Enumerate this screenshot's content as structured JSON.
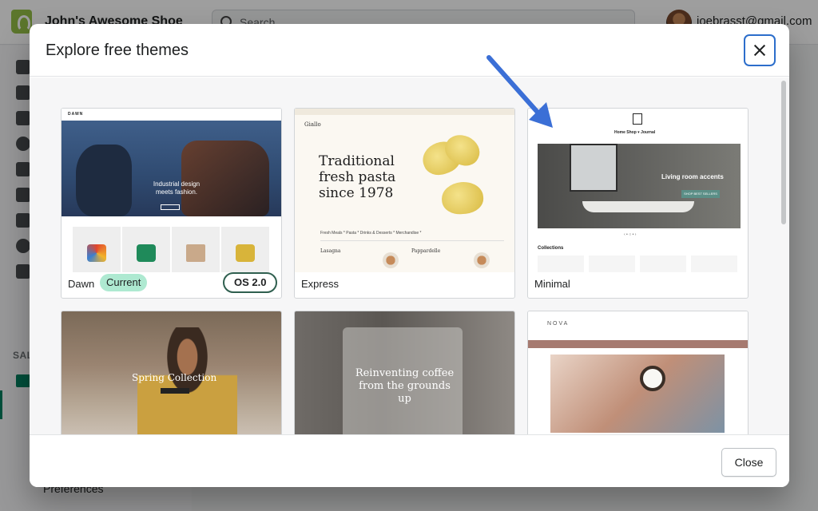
{
  "admin": {
    "store_name": "John's Awesome Shoe",
    "search_placeholder": "Search",
    "user_email": "joebrasst@gmail.com",
    "sidebar_section_label": "SAL",
    "sidebar_bottom_item": "Preferences"
  },
  "modal": {
    "title": "Explore free themes",
    "close_button": "Close"
  },
  "themes": [
    {
      "name": "Dawn",
      "badge": "Current",
      "tag": "OS 2.0",
      "preview": {
        "logo": "DAWN",
        "headline": "Industrial design meets fashion."
      }
    },
    {
      "name": "Express",
      "preview": {
        "brand": "Giallo",
        "headline": "Traditional fresh pasta since 1978",
        "tabs": "Fresh Meals *     Pasta *     Drinks & Desserts *     Merchandise *",
        "item_1": "Lasagna",
        "item_2": "Pappardelle"
      }
    },
    {
      "name": "Minimal",
      "preview": {
        "nav": "Home     Shop ▾     Journal",
        "headline": "Living room accents",
        "button": "SHOP BEST SELLERS",
        "section": "Collections",
        "pager": "‹   • ○ •   ›"
      }
    },
    {
      "name": "",
      "preview": {
        "headline": "Spring Collection"
      }
    },
    {
      "name": "",
      "preview": {
        "headline": "Reinventing coffee from the grounds up"
      }
    },
    {
      "name": "",
      "preview": {
        "brand": "NOVA"
      }
    }
  ],
  "colors": {
    "focus_ring": "#2c6ecb",
    "current_badge": "#aee9d1",
    "annotation_arrow": "#3b6fd6",
    "brand_green": "#008060"
  },
  "icons": [
    "search-icon",
    "close-icon",
    "shopify-logo-icon",
    "avatar",
    "arrow-annotation"
  ]
}
